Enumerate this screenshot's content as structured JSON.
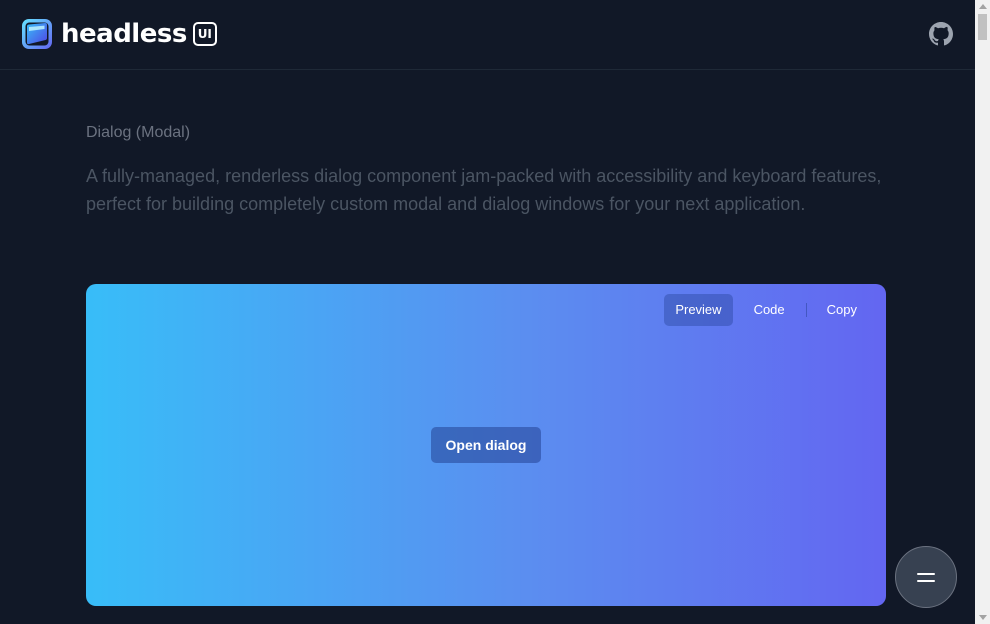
{
  "header": {
    "logo_text": "headless",
    "logo_badge": "UI",
    "github_icon": "github-icon"
  },
  "intro": {
    "title": "Dialog (Modal)",
    "description": "A fully-managed, renderless dialog component jam-packed with accessibility and keyboard features, perfect for building completely custom modal and dialog windows for your next application."
  },
  "preview": {
    "tabs": [
      {
        "label": "Preview",
        "active": true
      },
      {
        "label": "Code",
        "active": false
      }
    ],
    "copy_label": "Copy",
    "open_dialog_label": "Open dialog"
  },
  "fab": {
    "icon": "menu-icon"
  },
  "colors": {
    "background": "#111827",
    "gradient_start": "#38bdf8",
    "gradient_end": "#6366f1",
    "text_muted": "#6b7280"
  }
}
